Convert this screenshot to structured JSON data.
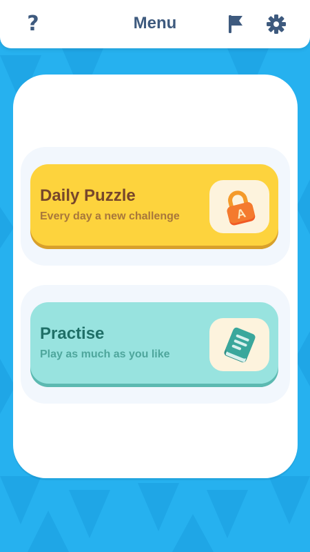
{
  "header": {
    "title": "Menu",
    "help_glyph": "?",
    "icons": {
      "help": "help-icon",
      "flag": "flag-icon",
      "settings": "gear-icon"
    },
    "icon_color": "#3e5a7e"
  },
  "modes": [
    {
      "title": "Daily Puzzle",
      "subtitle": "Every day a new challenge",
      "icon": "padlock-letter-icon",
      "icon_letter": "A",
      "color": "#fdd33d"
    },
    {
      "title": "Practise",
      "subtitle": "Play as much as you like",
      "icon": "book-icon",
      "color": "#98e3df"
    }
  ],
  "theme": {
    "background": "#26b1ef",
    "card": "#ffffff"
  }
}
